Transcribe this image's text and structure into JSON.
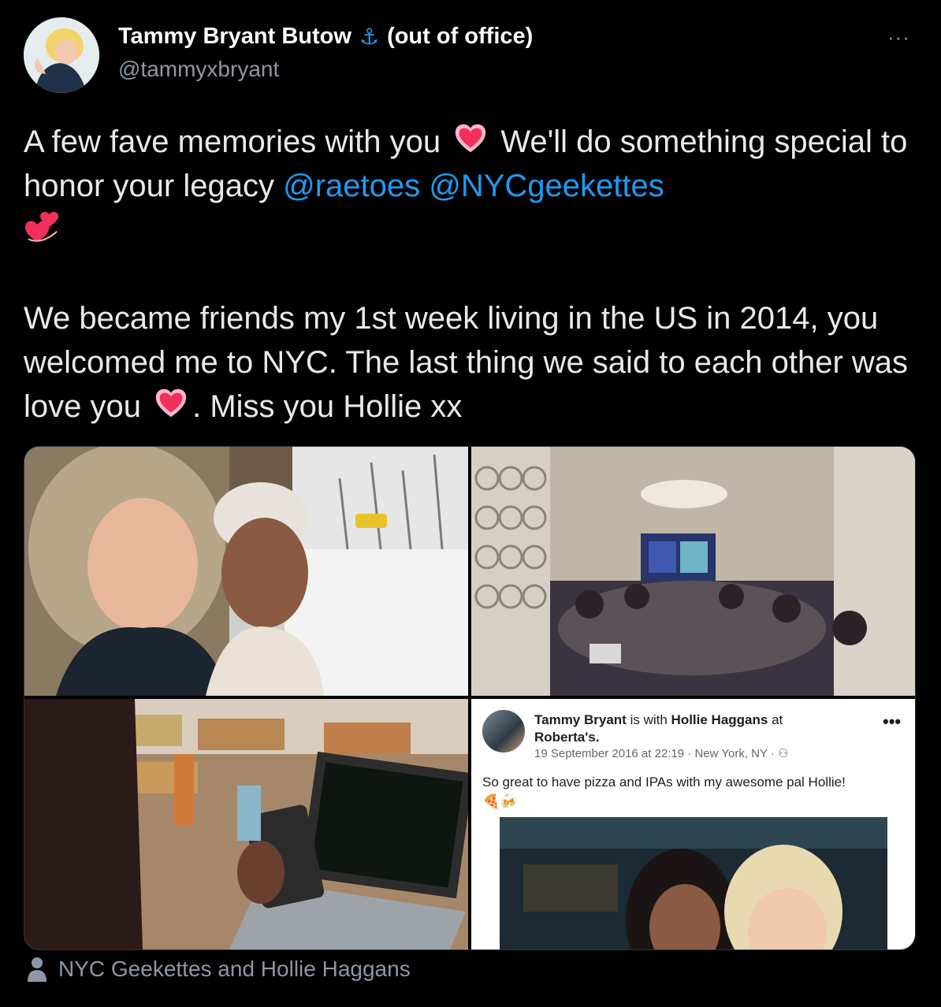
{
  "author": {
    "name": "Tammy Bryant Butow",
    "anchor_glyph": "⚓",
    "status": "(out of office)",
    "handle": "@tammyxbryant"
  },
  "more_glyph": "···",
  "tweet": {
    "p1_a": "A few fave memories with you",
    "p1_b": "We'll do something special to honor your legacy",
    "mention_1": "@raetoes",
    "mention_2": "@NYCgeekettes",
    "p2_a": "We became friends my 1st week living in the US in 2014, you welcomed me to NYC. The last thing we said to each other was love you",
    "p2_b": ". Miss you Hollie xx"
  },
  "fb_post": {
    "author": "Tammy Bryant",
    "with_text": "is with",
    "tagged": "Hollie Haggans",
    "at_text": "at",
    "place": "Roberta's.",
    "meta": "19 September 2016 at 22:19 · New York, NY · ⚇",
    "body": "So great to have pizza and IPAs with my awesome pal Hollie!",
    "emojis": "🍕🍻",
    "more_glyph": "•••"
  },
  "caption": "NYC Geekettes and Hollie Haggans",
  "colors": {
    "link": "#1d9bf0",
    "secondary": "#8b98a5",
    "background": "#000000"
  }
}
